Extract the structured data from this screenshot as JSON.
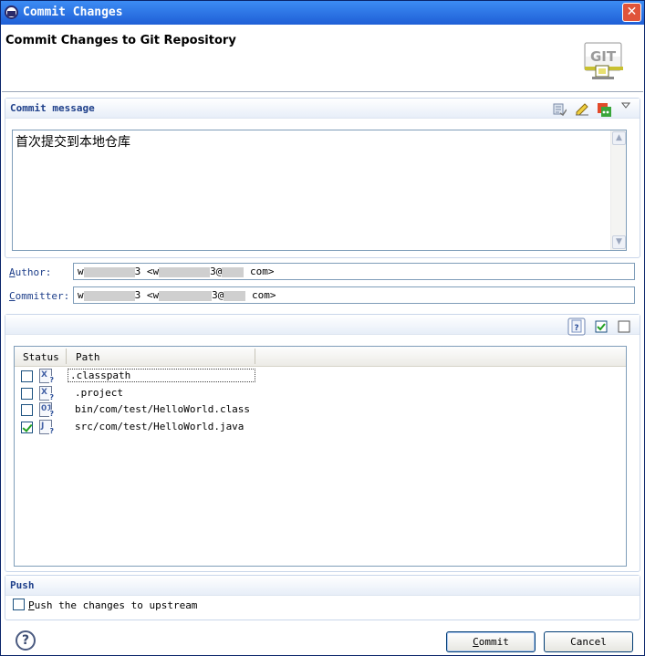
{
  "window": {
    "title": "Commit Changes",
    "close_glyph": "✕"
  },
  "banner": {
    "title": "Commit Changes to Git Repository",
    "icon_text": "GIT"
  },
  "commit_section": {
    "title": "Commit message",
    "message": "首次提交到本地仓库",
    "toolbar_icons": [
      "spellcheck-icon",
      "signed-off-icon",
      "amend-icon",
      "view-menu-icon"
    ]
  },
  "author": {
    "label_mnemonic": "A",
    "label_rest": "uthor:",
    "prefix": "w",
    "mid": "3 <w",
    "after_at": "3@",
    "suffix": "com>"
  },
  "committer": {
    "label_mnemonic": "C",
    "label_rest": "ommitter:",
    "prefix": "w",
    "mid": "3 <w",
    "after_at": "3@",
    "suffix": "com>"
  },
  "files_section": {
    "toolbar_icons": [
      "show-untracked-icon",
      "select-all-icon",
      "deselect-all-icon"
    ],
    "columns": [
      "Status",
      "Path"
    ],
    "rows": [
      {
        "path": ".classpath",
        "checked": false,
        "icon": "untracked-file-icon"
      },
      {
        "path": ".project",
        "checked": false,
        "icon": "untracked-file-icon"
      },
      {
        "path": "bin/com/test/HelloWorld.class",
        "checked": false,
        "icon": "untracked-class-file-icon"
      },
      {
        "path": "src/com/test/HelloWorld.java",
        "checked": true,
        "icon": "untracked-java-file-icon"
      }
    ]
  },
  "push_section": {
    "title": "Push",
    "checkbox_mnemonic": "P",
    "checkbox_rest": "ush the changes to upstream",
    "checked": false
  },
  "buttons": {
    "help": "?",
    "commit_mnemonic": "C",
    "commit_rest": "ommit",
    "cancel": "Cancel"
  }
}
